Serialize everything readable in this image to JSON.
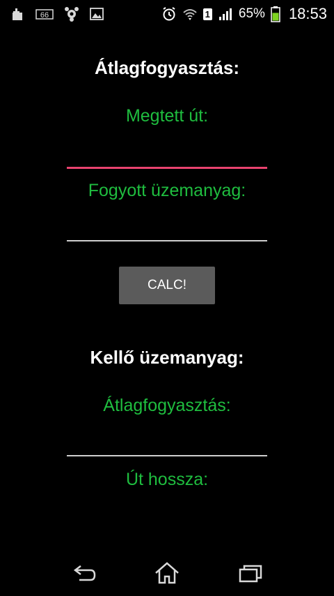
{
  "status_bar": {
    "notification_icons": [
      "cleaner-icon",
      "status-66-icon",
      "avast-icon",
      "image-icon"
    ],
    "badge_text": "66",
    "sim_badge": "1",
    "battery_percent": "65%",
    "battery_level": 0.65,
    "time": "18:53",
    "system_icons": [
      "alarm-icon",
      "wifi-icon",
      "signal-icon",
      "battery-icon"
    ]
  },
  "form": {
    "title": "Átlagfogyasztás:",
    "distance_label": "Megtett út:",
    "distance_value": "",
    "fuel_label": "Fogyott üzemanyag:",
    "fuel_value": "",
    "calc_label": "CALC!",
    "section2_title": "Kellő üzemanyag:",
    "avg_label": "Átlagfogyasztás:",
    "avg_value": "",
    "length_label": "Út hossza:"
  },
  "nav": {
    "icons": [
      "back-icon",
      "home-icon",
      "recent-apps-icon"
    ]
  },
  "colors": {
    "background": "#000000",
    "label_green": "#1fbd3f",
    "focus_accent": "#e8436e",
    "button_gray": "#5b5b5b"
  }
}
